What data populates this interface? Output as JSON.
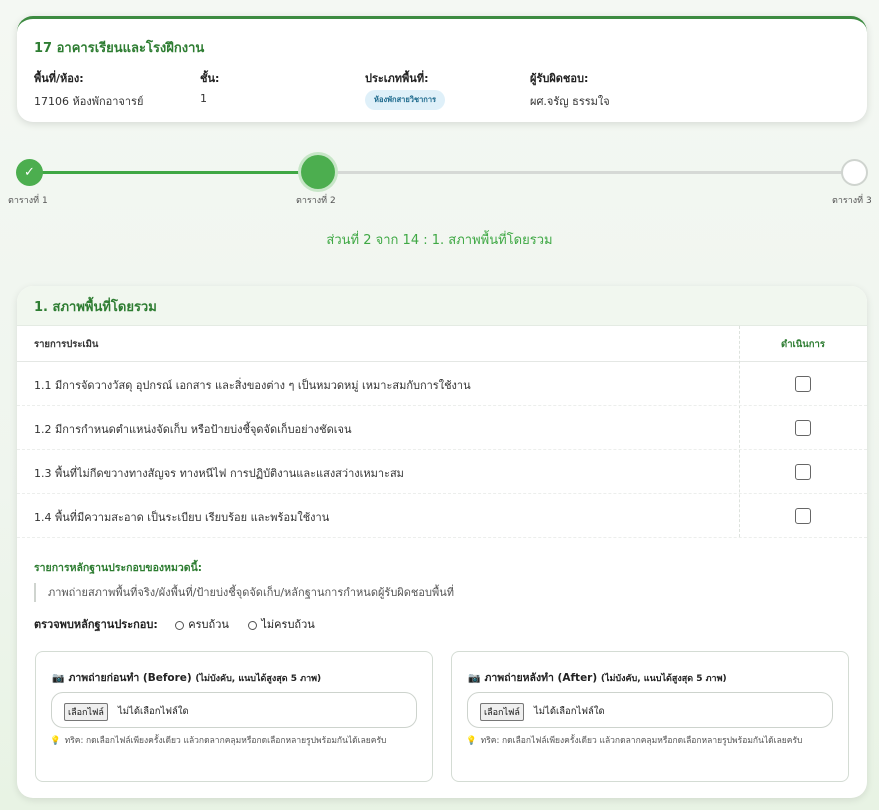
{
  "building": {
    "title": "17 อาคารเรียนและโรงฝึกงาน",
    "room_label": "พื้นที่/ห้อง:",
    "room_value": "17106 ห้องพักอาจารย์",
    "floor_label": "ชั้น:",
    "floor_value": "1",
    "type_label": "ประเภทพื้นที่:",
    "type_value": "ห้องพักสายวิชาการ",
    "owner_label": "ผู้รับผิดชอบ:",
    "owner_value": "ผศ.จรัญ ธรรมใจ"
  },
  "stepper": {
    "steps": [
      {
        "label": "ตารางที่ 1",
        "state": "done",
        "icon": "check-icon"
      },
      {
        "label": "ตารางที่ 2",
        "state": "current"
      },
      {
        "label": "ตารางที่ 3",
        "state": "todo"
      }
    ],
    "done_color": "#4cae4f"
  },
  "progress_text": "ส่วนที่ 2 จาก 14 : 1. สภาพพื้นที่โดยรวม",
  "section": {
    "title": "1. สภาพพื้นที่โดยรวม",
    "col_item": "รายการประเมิน",
    "col_action": "ดำเนินการ",
    "rows": [
      {
        "text": "1.1 มีการจัดวางวัสดุ อุปกรณ์ เอกสาร และสิ่งของต่าง ๆ เป็นหมวดหมู่ เหมาะสมกับการใช้งาน",
        "checked": false
      },
      {
        "text": "1.2 มีการกำหนดตำแหน่งจัดเก็บ หรือป้ายบ่งชี้จุดจัดเก็บอย่างชัดเจน",
        "checked": false
      },
      {
        "text": "1.3 พื้นที่ไม่กีดขวางทางสัญจร ทางหนีไฟ การปฏิบัติงานและแสงสว่างเหมาะสม",
        "checked": false
      },
      {
        "text": "1.4 พื้นที่มีความสะอาด เป็นระเบียบ เรียบร้อย และพร้อมใช้งาน",
        "checked": false
      }
    ],
    "evidence_title": "รายการหลักฐานประกอบของหมวดนี้:",
    "evidence_item": "ภาพถ่ายสภาพพื้นที่จริง/ผังพื้นที่/ป้ายบ่งชี้จุดจัดเก็บ/หลักฐานการกำหนดผู้รับผิดชอบพื้นที่",
    "found_label": "ตรวจพบหลักฐานประกอบ:",
    "found_options": [
      "ครบถ้วน",
      "ไม่ครบถ้วน"
    ],
    "uploads": [
      {
        "title": "ภาพถ่ายก่อนทำ (Before)",
        "subtitle": "(ไม่บังคับ, แนบได้สูงสุด 5 ภาพ)",
        "button": "เลือกไฟล์",
        "no_file": "ไม่ได้เลือกไฟล์ใด",
        "tip": "ทริค: กดเลือกไฟล์เพียงครั้งเดียว แล้วกดลากคลุมหรือกดเลือกหลายรูปพร้อมกันได้เลยครับ"
      },
      {
        "title": "ภาพถ่ายหลังทำ (After)",
        "subtitle": "(ไม่บังคับ, แนบได้สูงสุด 5 ภาพ)",
        "button": "เลือกไฟล์",
        "no_file": "ไม่ได้เลือกไฟล์ใด",
        "tip": "ทริค: กดเลือกไฟล์เพียงครั้งเดียว แล้วกดลากคลุมหรือกดเลือกหลายรูปพร้อมกันได้เลยครับ"
      }
    ]
  }
}
